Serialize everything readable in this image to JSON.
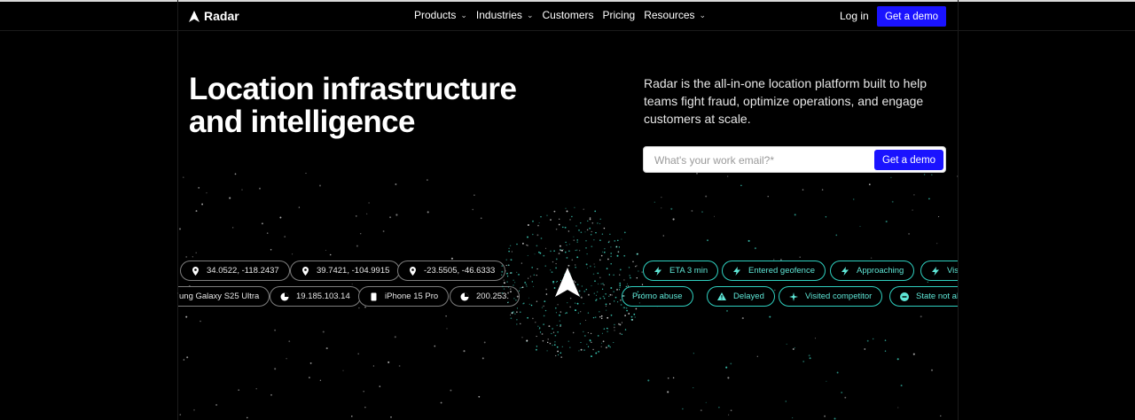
{
  "brand": {
    "name": "Radar"
  },
  "nav": {
    "items": [
      {
        "label": "Products",
        "dropdown": true
      },
      {
        "label": "Industries",
        "dropdown": true
      },
      {
        "label": "Customers",
        "dropdown": false
      },
      {
        "label": "Pricing",
        "dropdown": false
      },
      {
        "label": "Resources",
        "dropdown": true
      }
    ],
    "login_label": "Log in",
    "demo_label": "Get a demo"
  },
  "hero": {
    "headline_line1": "Location infrastructure",
    "headline_line2": "and intelligence",
    "description": "Radar is the all-in-one location platform built to help teams fight fraud, optimize operations, and engage customers at scale.",
    "email_placeholder": "What's your work email?*",
    "email_button": "Get a demo"
  },
  "chips": {
    "row1_left": [
      {
        "label": "34.0522, -118.2437",
        "icon": "pin-icon"
      },
      {
        "label": "39.7421, -104.9915",
        "icon": "pin-icon"
      },
      {
        "label": "-23.5505, -46.6333",
        "icon": "pin-icon"
      }
    ],
    "row2_left": [
      {
        "label": "ung Galaxy S25 Ultra",
        "icon": ""
      },
      {
        "label": "19.185.103.14",
        "icon": "ip-icon"
      },
      {
        "label": "iPhone 15 Pro",
        "icon": "phone-icon"
      },
      {
        "label": "200.253.",
        "icon": "ip-icon"
      }
    ],
    "row1_right": [
      {
        "label": "ETA 3 min",
        "icon": "bolt-icon"
      },
      {
        "label": "Entered geofence",
        "icon": "bolt-icon"
      },
      {
        "label": "Approaching",
        "icon": "bolt-icon"
      },
      {
        "label": "Visi",
        "icon": "bolt-icon"
      }
    ],
    "row2_right": [
      {
        "label": "Promo abuse",
        "icon": ""
      },
      {
        "label": "Delayed",
        "icon": "warning-icon"
      },
      {
        "label": "Visited competitor",
        "icon": "sparkle-icon"
      },
      {
        "label": "State not all",
        "icon": "minus-circle-icon"
      }
    ]
  },
  "colors": {
    "accent": "#1a13ff",
    "teal": "#2fcfbf",
    "background": "#000000"
  }
}
